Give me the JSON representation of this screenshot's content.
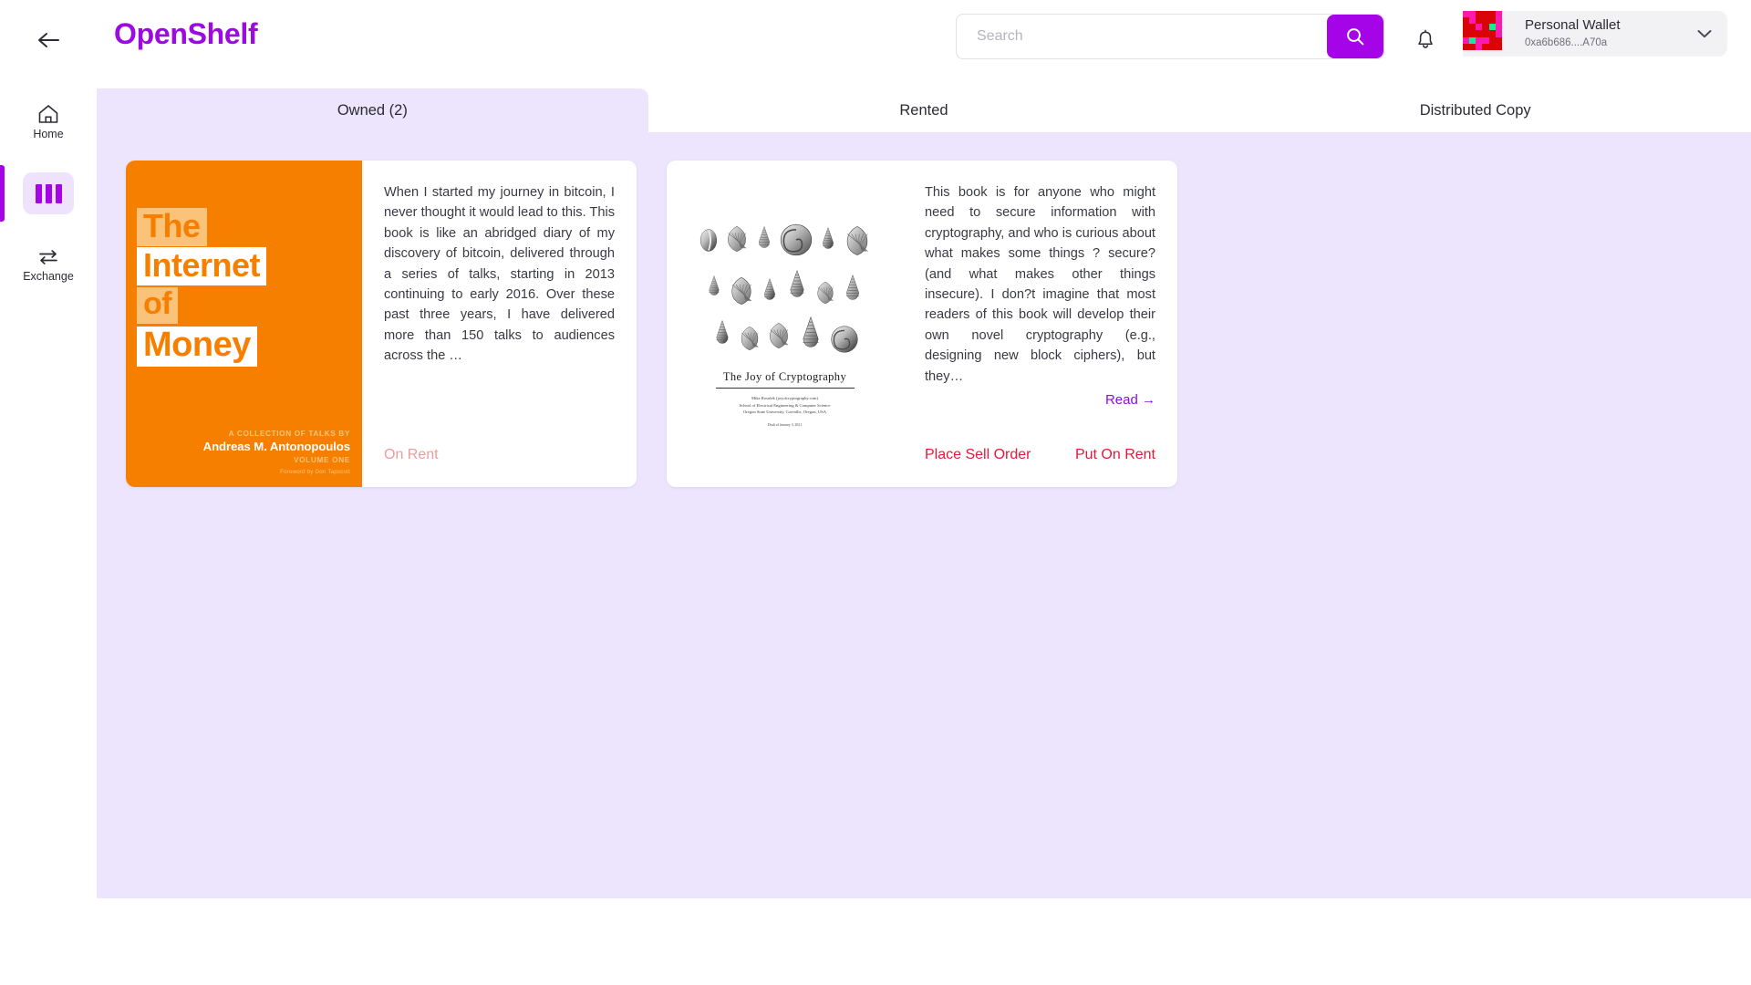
{
  "header": {
    "back_icon": "arrow-left-icon",
    "brand": "OpenShelf",
    "brand_color": "#9B0AE0",
    "search": {
      "value": "",
      "placeholder": "Search",
      "button_icon": "search-icon",
      "button_color": "#A504E8"
    },
    "notifications_icon": "bell-icon",
    "wallet": {
      "name": "Personal Wallet",
      "address": "0xa6b686....A70a",
      "chevron_icon": "chevron-down-icon",
      "avatar_icon": "identicon-avatar"
    }
  },
  "sidebar": {
    "items": [
      {
        "label": "Home",
        "icon": "home-icon",
        "active": false
      },
      {
        "label": "",
        "icon": "bookshelf-icon",
        "active": true
      },
      {
        "label": "Exchange",
        "icon": "exchange-arrows-icon",
        "active": false
      }
    ],
    "active_color": "#A504E8"
  },
  "main": {
    "background_color": "#EDE4FE",
    "tabs": [
      {
        "label": "Owned (2)",
        "active": true
      },
      {
        "label": "Rented",
        "active": false
      },
      {
        "label": "Distributed Copy",
        "active": false
      }
    ],
    "cards": [
      {
        "cover_type": "internet-of-money",
        "cover": {
          "title_lines": [
            "The",
            "Internet",
            "of",
            "Money"
          ],
          "collection": "A COLLECTION OF TALKS BY",
          "author": "Andreas M. Antonopoulos",
          "volume": "VOLUME ONE",
          "foreword": "Foreword by Don Tapscott",
          "bg_color": "#F77F00"
        },
        "description": "When I started my journey in bitcoin, I never thought it would lead to this. This book is like an abridged diary of my discovery of bitcoin, delivered through a series of talks, starting in 2013 continuing to early 2016. Over these past three years, I have delivered more than 150 talks to audiences across the …",
        "read_label": "",
        "status": "On Rent",
        "status_color": "#EE9B9B",
        "actions": []
      },
      {
        "cover_type": "joy-of-cryptography",
        "cover": {
          "title": "The Joy of Cryptography",
          "subtitle": "Mike Rosulek  (joyofcryptography.com)\nSchool of Electrical Engineering & Computer Science\nOregon State University, Corvallis, Oregon, USA",
          "date": "Draft of January 3, 2021",
          "bg_color": "#FFFFFF"
        },
        "description": "This book is for anyone who might need to secure information with cryptography, and who is curious about what makes some things ? secure? (and what makes other things insecure). I don?t imagine that most readers of this book will develop their own novel cryptography (e.g., designing new block ciphers), but they…",
        "read_label": "Read →",
        "status": "",
        "status_color": "",
        "actions": [
          {
            "label": "Place Sell Order",
            "color": "#E5183A"
          },
          {
            "label": "Put On Rent",
            "color": "#E5183A"
          }
        ]
      }
    ]
  }
}
